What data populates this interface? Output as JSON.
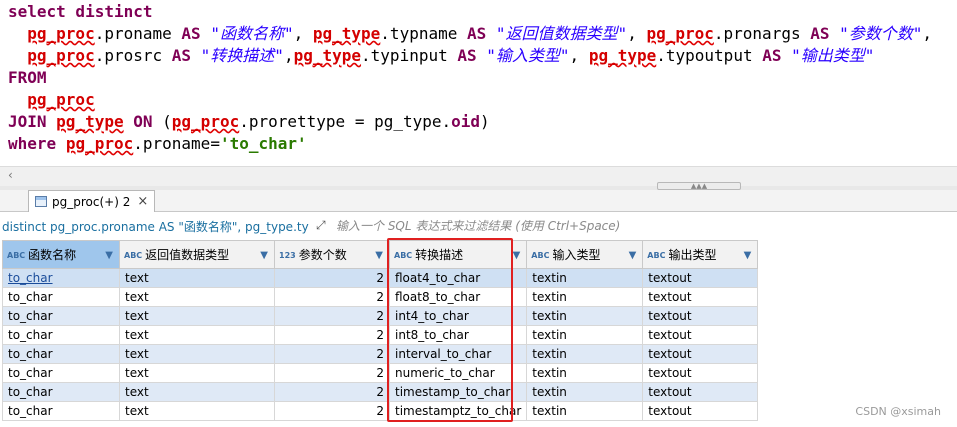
{
  "editor": {
    "lines": [
      [
        {
          "t": "select distinct",
          "c": "kw"
        }
      ],
      [
        {
          "t": "  ",
          "c": "pln"
        },
        {
          "t": "pg_proc",
          "c": "tbl"
        },
        {
          "t": ".proname ",
          "c": "pln"
        },
        {
          "t": "AS",
          "c": "kw"
        },
        {
          "t": " ",
          "c": "pln"
        },
        {
          "t": "\"函数名称\"",
          "c": "str"
        },
        {
          "t": ", ",
          "c": "pln"
        },
        {
          "t": "pg_type",
          "c": "tbl"
        },
        {
          "t": ".typname ",
          "c": "pln"
        },
        {
          "t": "AS",
          "c": "kw"
        },
        {
          "t": " ",
          "c": "pln"
        },
        {
          "t": "\"返回值数据类型\"",
          "c": "str"
        },
        {
          "t": ", ",
          "c": "pln"
        },
        {
          "t": "pg_proc",
          "c": "tbl"
        },
        {
          "t": ".pronargs ",
          "c": "pln"
        },
        {
          "t": "AS",
          "c": "kw"
        },
        {
          "t": " ",
          "c": "pln"
        },
        {
          "t": "\"参数个数\"",
          "c": "str"
        },
        {
          "t": ",",
          "c": "pln"
        }
      ],
      [
        {
          "t": "  ",
          "c": "pln"
        },
        {
          "t": "pg_proc",
          "c": "tbl"
        },
        {
          "t": ".prosrc ",
          "c": "pln"
        },
        {
          "t": "AS",
          "c": "kw"
        },
        {
          "t": " ",
          "c": "pln"
        },
        {
          "t": "\"转换描述\"",
          "c": "str"
        },
        {
          "t": ",",
          "c": "pln"
        },
        {
          "t": "pg_type",
          "c": "tbl"
        },
        {
          "t": ".typinput ",
          "c": "pln"
        },
        {
          "t": "AS",
          "c": "kw"
        },
        {
          "t": " ",
          "c": "pln"
        },
        {
          "t": "\"输入类型\"",
          "c": "str"
        },
        {
          "t": ", ",
          "c": "pln"
        },
        {
          "t": "pg_type",
          "c": "tbl"
        },
        {
          "t": ".typoutput ",
          "c": "pln"
        },
        {
          "t": "AS",
          "c": "kw"
        },
        {
          "t": " ",
          "c": "pln"
        },
        {
          "t": "\"输出类型\"",
          "c": "str"
        }
      ],
      [
        {
          "t": "FROM",
          "c": "kw"
        }
      ],
      [
        {
          "t": "  ",
          "c": "pln"
        },
        {
          "t": "pg_proc",
          "c": "tbl"
        }
      ],
      [
        {
          "t": "JOIN",
          "c": "kw"
        },
        {
          "t": " ",
          "c": "pln"
        },
        {
          "t": "pg_type",
          "c": "tbl"
        },
        {
          "t": " ",
          "c": "pln"
        },
        {
          "t": "ON",
          "c": "kw"
        },
        {
          "t": " (",
          "c": "pln"
        },
        {
          "t": "pg_proc",
          "c": "tbl"
        },
        {
          "t": ".prorettype = pg_type.",
          "c": "pln"
        },
        {
          "t": "oid",
          "c": "kw"
        },
        {
          "t": ")",
          "c": "pln"
        }
      ],
      [
        {
          "t": "where",
          "c": "kw"
        },
        {
          "t": " ",
          "c": "pln"
        },
        {
          "t": "pg_proc",
          "c": "tbl"
        },
        {
          "t": ".proname=",
          "c": "pln"
        },
        {
          "t": "'to_char'",
          "c": "lit"
        }
      ]
    ]
  },
  "tab": {
    "label": "pg_proc(+) 2",
    "close": "×"
  },
  "filter": {
    "sql_text": "distinct pg_proc.proname AS \"函数名称\", pg_type.typname",
    "placeholder": "输入一个 SQL 表达式来过滤结果 (使用 Ctrl+Space)"
  },
  "grid": {
    "columns": [
      {
        "type": "ABC",
        "label": "函数名称"
      },
      {
        "type": "ABC",
        "label": "返回值数据类型"
      },
      {
        "type": "123",
        "label": "参数个数"
      },
      {
        "type": "ABC",
        "label": "转换描述"
      },
      {
        "type": "ABC",
        "label": "输入类型"
      },
      {
        "type": "ABC",
        "label": "输出类型"
      }
    ],
    "rows": [
      [
        "to_char",
        "text",
        "2",
        "float4_to_char",
        "textin",
        "textout"
      ],
      [
        "to_char",
        "text",
        "2",
        "float8_to_char",
        "textin",
        "textout"
      ],
      [
        "to_char",
        "text",
        "2",
        "int4_to_char",
        "textin",
        "textout"
      ],
      [
        "to_char",
        "text",
        "2",
        "int8_to_char",
        "textin",
        "textout"
      ],
      [
        "to_char",
        "text",
        "2",
        "interval_to_char",
        "textin",
        "textout"
      ],
      [
        "to_char",
        "text",
        "2",
        "numeric_to_char",
        "textin",
        "textout"
      ],
      [
        "to_char",
        "text",
        "2",
        "timestamp_to_char",
        "textin",
        "textout"
      ],
      [
        "to_char",
        "text",
        "2",
        "timestamptz_to_char",
        "textin",
        "textout"
      ]
    ]
  },
  "watermark": "CSDN @xsimah"
}
